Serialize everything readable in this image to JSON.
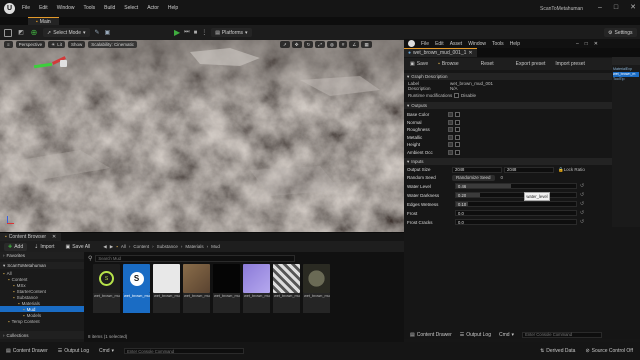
{
  "app": {
    "project_title": "ScanToMetahuman",
    "menu": [
      "File",
      "Edit",
      "Window",
      "Tools",
      "Build",
      "Select",
      "Actor",
      "Help"
    ],
    "main_tab": "Main"
  },
  "toolbar": {
    "select_mode": "Select Mode",
    "platforms": "Platforms",
    "settings": "Settings"
  },
  "viewport": {
    "perspective": "Perspective",
    "lit": "Lit",
    "show": "Show",
    "scalability": "Scalability: Cinematic"
  },
  "content_browser": {
    "tab": "Content Browser",
    "add": "Add",
    "import": "Import",
    "save_all": "Save All",
    "breadcrumb": [
      "All",
      "Content",
      "Substance",
      "Materials",
      "Mud"
    ],
    "search_placeholder": "Search Mud",
    "favorites": "Favorites",
    "project_root": "ScanToMetahuman",
    "tree": [
      {
        "label": "All",
        "indent": 0
      },
      {
        "label": "Content",
        "indent": 1
      },
      {
        "label": "MSx",
        "indent": 2
      },
      {
        "label": "StarterContent",
        "indent": 2
      },
      {
        "label": "Substance",
        "indent": 2
      },
      {
        "label": "Materials",
        "indent": 3
      },
      {
        "label": "Mud",
        "indent": 4,
        "selected": true
      },
      {
        "label": "Models",
        "indent": 4
      },
      {
        "label": "Temp Content",
        "indent": 1
      }
    ],
    "assets": [
      {
        "label": "wet_brown_mud_001"
      },
      {
        "label": "wet_brown_mud_001_1",
        "selected": true
      },
      {
        "label": "wet_brown_mud_001_INST"
      },
      {
        "label": "wet_brown_mud_001_INST_basecolor"
      },
      {
        "label": "wet_brown_mud_001_INST_height"
      },
      {
        "label": "wet_brown_mud_001_INST_normal"
      },
      {
        "label": "wet_brown_mud_001_INST"
      },
      {
        "label": "wet_brown_mud_001"
      }
    ],
    "item_count": "8 items (1 selected)",
    "collections": "Collections"
  },
  "material_editor": {
    "tab_label": "wet_brown_mud_001_1",
    "menu": [
      "File",
      "Edit",
      "Asset",
      "Window",
      "Tools",
      "Help"
    ],
    "toolbar": [
      "Save",
      "Browse",
      "Reset",
      "Export preset",
      "Import preset"
    ],
    "graph_section": "Graph Description",
    "label_key": "Label",
    "label_value": "wet_brown_mud_001",
    "description_key": "Description",
    "description_value": "N/A",
    "runtime_key": "Runtime modifications",
    "runtime_value": "Disable",
    "outputs_section": "Outputs",
    "outputs": [
      "Base Color",
      "Normal",
      "Roughness",
      "Metallic",
      "Height",
      "Ambient Occ"
    ],
    "inputs_section": "Inputs",
    "output_size_key": "Output Size",
    "output_size_w": "2048",
    "output_size_h": "2048",
    "lock_ratio": "Lock Ratio",
    "random_seed_key": "Random Seed",
    "randomize_seed": "Randomize Seed",
    "random_seed_value": "0",
    "sliders": [
      {
        "label": "Water Level",
        "value": 0.46,
        "text": "0.46"
      },
      {
        "label": "Water Darkness",
        "value": 0.2,
        "text": "0.20"
      },
      {
        "label": "Edges Wetness",
        "value": 0.1,
        "text": "0.10"
      },
      {
        "label": "Frost",
        "value": 0.0,
        "text": "0.0"
      },
      {
        "label": "Frost Cracks",
        "value": 0.0,
        "text": "0.0"
      }
    ],
    "tooltip": "water_level",
    "right_panel_items": [
      "MaterialExp",
      "wet_brown_m",
      "ToolTip"
    ]
  },
  "status": {
    "content_drawer": "Content Drawer",
    "output_log": "Output Log",
    "cmd": "Cmd",
    "cmd_placeholder": "Enter Console Command",
    "derived_data": "Derived Data",
    "source_control": "Source Control Off"
  },
  "colors": {
    "accent": "#e49a2a",
    "selection": "#1a6cc4",
    "play": "#3fae3f"
  }
}
